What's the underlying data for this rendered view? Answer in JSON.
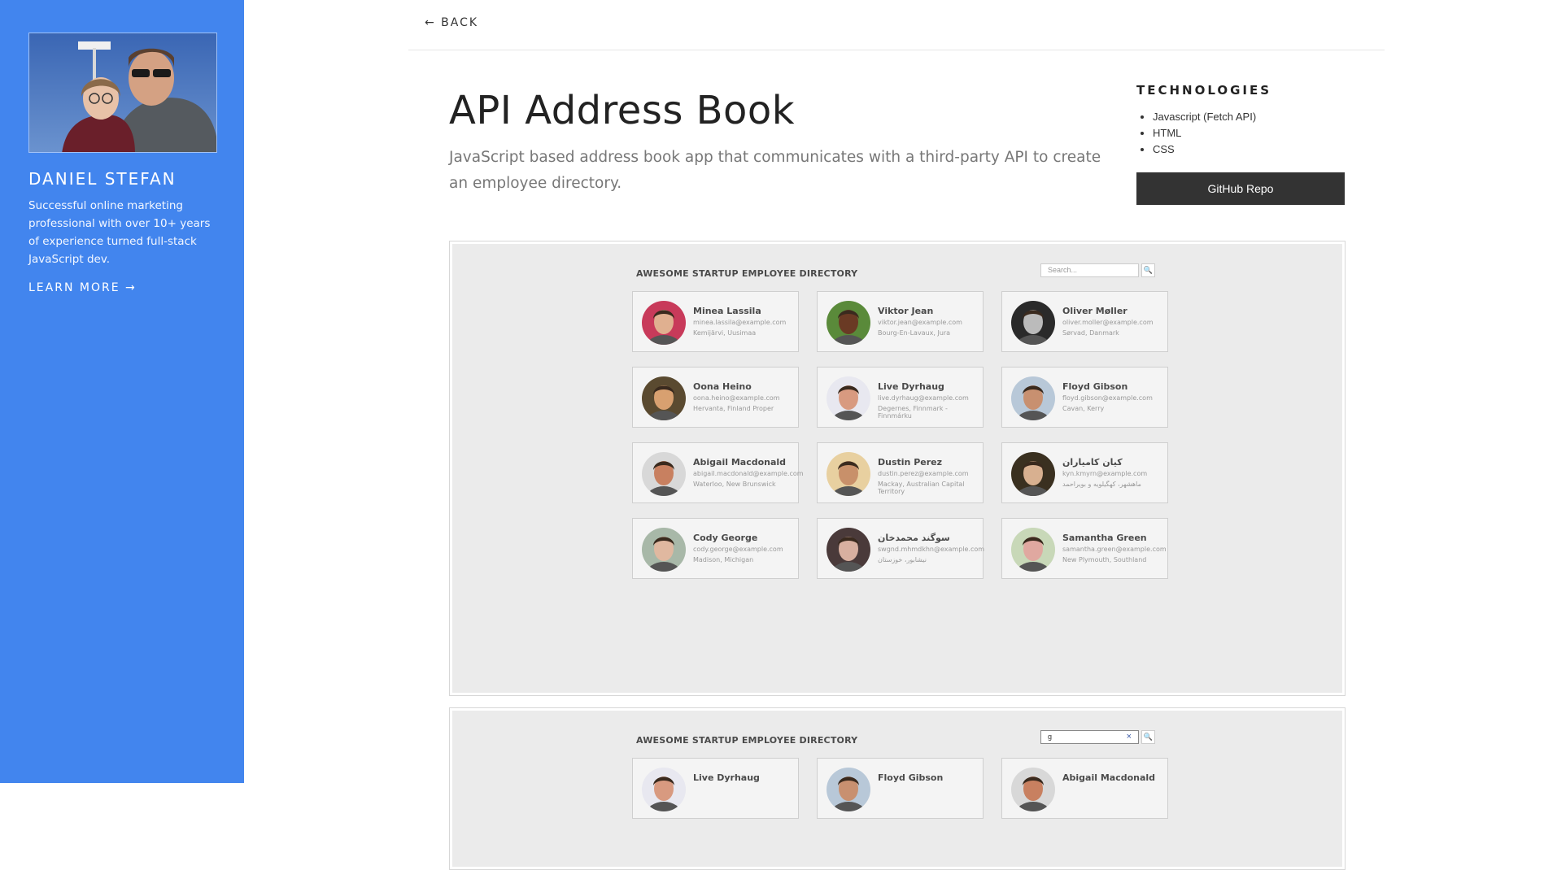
{
  "sidebar": {
    "name": "DANIEL STEFAN",
    "bio": "Successful online marketing professional with over 10+ years of experience turned full-stack JavaScript dev.",
    "learn_more": "LEARN MORE →"
  },
  "nav": {
    "back": "← BACK"
  },
  "project": {
    "title": "API Address Book",
    "description": "JavaScript based address book app that communicates with a third-party API to create an employee directory."
  },
  "technologies": {
    "heading": "TECHNOLOGIES",
    "items": [
      "Javascript (Fetch API)",
      "HTML",
      "CSS"
    ],
    "github_label": "GitHub Repo"
  },
  "screenshot1": {
    "directory_title": "AWESOME STARTUP EMPLOYEE DIRECTORY",
    "search_placeholder": "Search...",
    "search_icon": "🔍",
    "cards": [
      {
        "name": "Minea Lassila",
        "email": "minea.lassila@example.com",
        "location": "Kemijärvi, Uusimaa",
        "avatar_color": "#c83a5a",
        "skin": "#e0b090"
      },
      {
        "name": "Viktor Jean",
        "email": "viktor.jean@example.com",
        "location": "Bourg-En-Lavaux, Jura",
        "avatar_color": "#5a8a3a",
        "skin": "#6a3a24"
      },
      {
        "name": "Oliver Møller",
        "email": "oliver.moller@example.com",
        "location": "Sørvad, Danmark",
        "avatar_color": "#2a2a2a",
        "skin": "#bbbbbb"
      },
      {
        "name": "Oona Heino",
        "email": "oona.heino@example.com",
        "location": "Hervanta, Finland Proper",
        "avatar_color": "#5a4a30",
        "skin": "#d8a070"
      },
      {
        "name": "Live Dyrhaug",
        "email": "live.dyrhaug@example.com",
        "location": "Degernes, Finnmark - Finnmárku",
        "avatar_color": "#e8e8f0",
        "skin": "#d89a80"
      },
      {
        "name": "Floyd Gibson",
        "email": "floyd.gibson@example.com",
        "location": "Cavan, Kerry",
        "avatar_color": "#b8c8d8",
        "skin": "#c89070"
      },
      {
        "name": "Abigail Macdonald",
        "email": "abigail.macdonald@example.com",
        "location": "Waterloo, New Brunswick",
        "avatar_color": "#d8d8d8",
        "skin": "#c88060"
      },
      {
        "name": "Dustin Perez",
        "email": "dustin.perez@example.com",
        "location": "Mackay, Australian Capital Territory",
        "avatar_color": "#e8d0a0",
        "skin": "#c8906a"
      },
      {
        "name": "کیان کامیاران",
        "email": "kyn.kmyrn@example.com",
        "location": "ماهشهر، کهگیلویه و بویراحمد",
        "avatar_color": "#3a3020",
        "skin": "#d8b090"
      },
      {
        "name": "Cody George",
        "email": "cody.george@example.com",
        "location": "Madison, Michigan",
        "avatar_color": "#a8b8a8",
        "skin": "#e0b8a0"
      },
      {
        "name": "سوگند محمدخان",
        "email": "swgnd.mhmdkhn@example.com",
        "location": "نیشابور، خوزستان",
        "avatar_color": "#4a3a3a",
        "skin": "#d8b0a0"
      },
      {
        "name": "Samantha Green",
        "email": "samantha.green@example.com",
        "location": "New Plymouth, Southland",
        "avatar_color": "#c8d8b8",
        "skin": "#e0a8a0"
      }
    ]
  },
  "screenshot2": {
    "directory_title": "AWESOME STARTUP EMPLOYEE DIRECTORY",
    "search_value": "g",
    "clear_icon": "×",
    "search_icon": "🔍",
    "cards": [
      {
        "name": "Live Dyrhaug",
        "avatar_color": "#e8e8f0",
        "skin": "#d89a80"
      },
      {
        "name": "Floyd Gibson",
        "avatar_color": "#b8c8d8",
        "skin": "#c89070"
      },
      {
        "name": "Abigail Macdonald",
        "avatar_color": "#d8d8d8",
        "skin": "#c88060"
      }
    ]
  }
}
